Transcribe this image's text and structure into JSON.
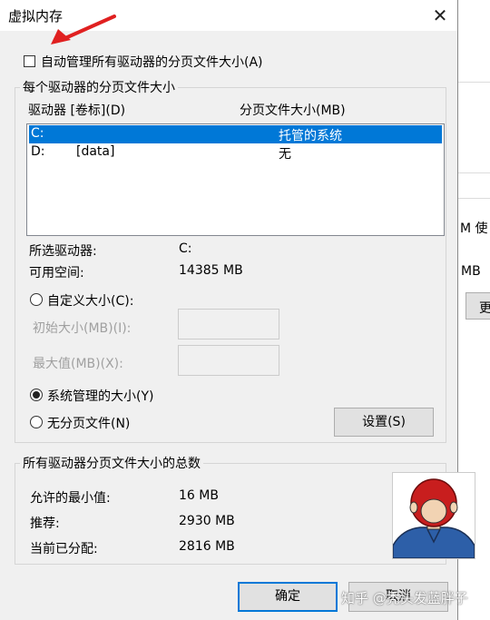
{
  "window": {
    "title": "虚拟内存",
    "close_glyph": "✕"
  },
  "auto_manage": {
    "label": "自动管理所有驱动器的分页文件大小(A)",
    "checked": false
  },
  "drives_group": {
    "title": "每个驱动器的分页文件大小",
    "col_drive": "驱动器 [卷标](D)",
    "col_size": "分页文件大小(MB)",
    "rows": [
      {
        "drive": "C:",
        "label": "",
        "size": "托管的系统",
        "selected": true
      },
      {
        "drive": "D:",
        "label": "[data]",
        "size": "无",
        "selected": false
      }
    ],
    "selected_drive_label": "所选驱动器:",
    "selected_drive_value": "C:",
    "free_space_label": "可用空间:",
    "free_space_value": "14385 MB",
    "custom_size_label": "自定义大小(C):",
    "initial_size_label": "初始大小(MB)(I):",
    "max_size_label": "最大值(MB)(X):",
    "initial_size_value": "",
    "max_size_value": "",
    "system_managed_label": "系统管理的大小(Y)",
    "no_paging_label": "无分页文件(N)",
    "set_button": "设置(S)"
  },
  "totals_group": {
    "title": "所有驱动器分页文件大小的总数",
    "min_allowed_label": "允许的最小值:",
    "min_allowed_value": "16 MB",
    "recommended_label": "推荐:",
    "recommended_value": "2930 MB",
    "current_label": "当前已分配:",
    "current_value": "2816 MB"
  },
  "buttons": {
    "ok": "确定",
    "cancel": "取消"
  },
  "background": {
    "frag1": "M 使",
    "frag2": "MB",
    "frag3": "更"
  },
  "watermark": "知乎 @秃头发蓝胖子",
  "colors": {
    "selection": "#0078d7",
    "arrow": "#e02020",
    "avatar_hair": "#c81e1e",
    "avatar_shirt": "#2d5fa8"
  },
  "icons": {
    "arrow": "red-arrow-icon",
    "avatar": "avatar-cartoon"
  }
}
